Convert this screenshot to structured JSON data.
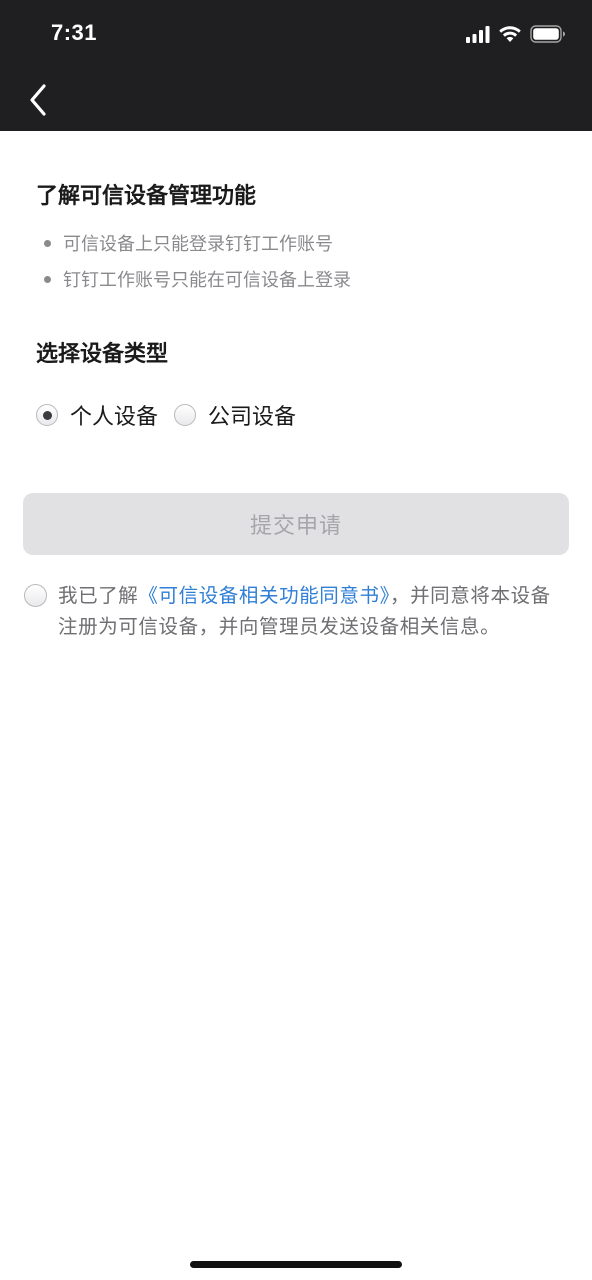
{
  "status_bar": {
    "time": "7:31",
    "icons": [
      "cellular-signal-icon",
      "wifi-icon",
      "battery-icon"
    ]
  },
  "nav": {
    "back_icon": "chevron-left-icon"
  },
  "feature_section": {
    "title": "了解可信设备管理功能",
    "bullets": [
      "可信设备上只能登录钉钉工作账号",
      "钉钉工作账号只能在可信设备上登录"
    ]
  },
  "device_type_section": {
    "title": "选择设备类型",
    "options": [
      {
        "label": "个人设备",
        "selected": true
      },
      {
        "label": "公司设备",
        "selected": false
      }
    ]
  },
  "submit_button": {
    "label": "提交申请",
    "enabled": false
  },
  "agreement": {
    "checked": false,
    "prefix": "我已了解",
    "link_text": "《可信设备相关功能同意书》",
    "suffix": "，并同意将本设备注册为可信设备，并向管理员发送设备相关信息。"
  },
  "colors": {
    "top_bar": "#1f1f21",
    "link": "#2f7fd6",
    "disabled_button_bg": "#e1e1e3",
    "disabled_button_text": "#a6a6aa"
  }
}
